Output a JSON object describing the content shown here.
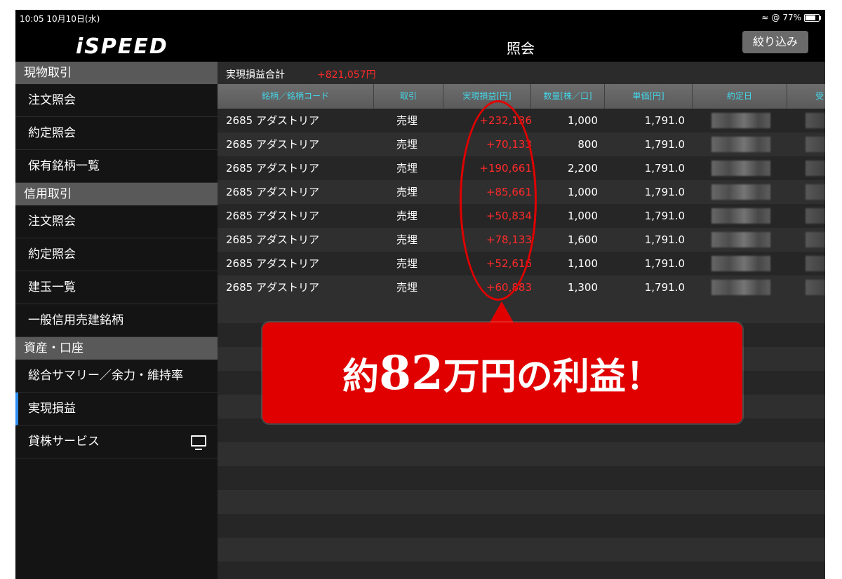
{
  "status_bar": {
    "time_date": "10:05  10月10日(水)",
    "battery": "77%"
  },
  "header": {
    "logo": "iSPEED",
    "title": "照会",
    "filter_button": "絞り込み"
  },
  "sidebar": {
    "sections": [
      {
        "title": "現物取引",
        "items": [
          "注文照会",
          "約定照会",
          "保有銘柄一覧"
        ]
      },
      {
        "title": "信用取引",
        "items": [
          "注文照会",
          "約定照会",
          "建玉一覧",
          "一般信用売建銘柄"
        ]
      },
      {
        "title": "資産・口座",
        "items": [
          "総合サマリー／余力・維持率",
          "実現損益",
          "貸株サービス"
        ]
      }
    ],
    "active_item": "実現損益"
  },
  "summary": {
    "label": "実現損益合計",
    "value": "+821,057円"
  },
  "table": {
    "headers": [
      "銘柄／銘柄コード",
      "取引",
      "実現損益[円]",
      "数量[株／口]",
      "単価[円]",
      "約定日",
      "受"
    ],
    "rows": [
      {
        "stock": "2685 アダストリア",
        "type": "売埋",
        "pl": "+232,136",
        "qty": "1,000",
        "price": "1,791.0"
      },
      {
        "stock": "2685 アダストリア",
        "type": "売埋",
        "pl": "+70,133",
        "qty": "800",
        "price": "1,791.0"
      },
      {
        "stock": "2685 アダストリア",
        "type": "売埋",
        "pl": "+190,661",
        "qty": "2,200",
        "price": "1,791.0"
      },
      {
        "stock": "2685 アダストリア",
        "type": "売埋",
        "pl": "+85,661",
        "qty": "1,000",
        "price": "1,791.0"
      },
      {
        "stock": "2685 アダストリア",
        "type": "売埋",
        "pl": "+50,834",
        "qty": "1,000",
        "price": "1,791.0"
      },
      {
        "stock": "2685 アダストリア",
        "type": "売埋",
        "pl": "+78,133",
        "qty": "1,600",
        "price": "1,791.0"
      },
      {
        "stock": "2685 アダストリア",
        "type": "売埋",
        "pl": "+52,616",
        "qty": "1,100",
        "price": "1,791.0"
      },
      {
        "stock": "2685 アダストリア",
        "type": "売埋",
        "pl": "+60,883",
        "qty": "1,300",
        "price": "1,791.0"
      }
    ]
  },
  "callout": {
    "prefix": "約",
    "amount": "82",
    "suffix": "万円の利益！"
  },
  "colors": {
    "profit": "#ff2a2a",
    "header_text": "#44d6e8",
    "callout": "#e00000",
    "active_bar": "#2d8ef0"
  }
}
